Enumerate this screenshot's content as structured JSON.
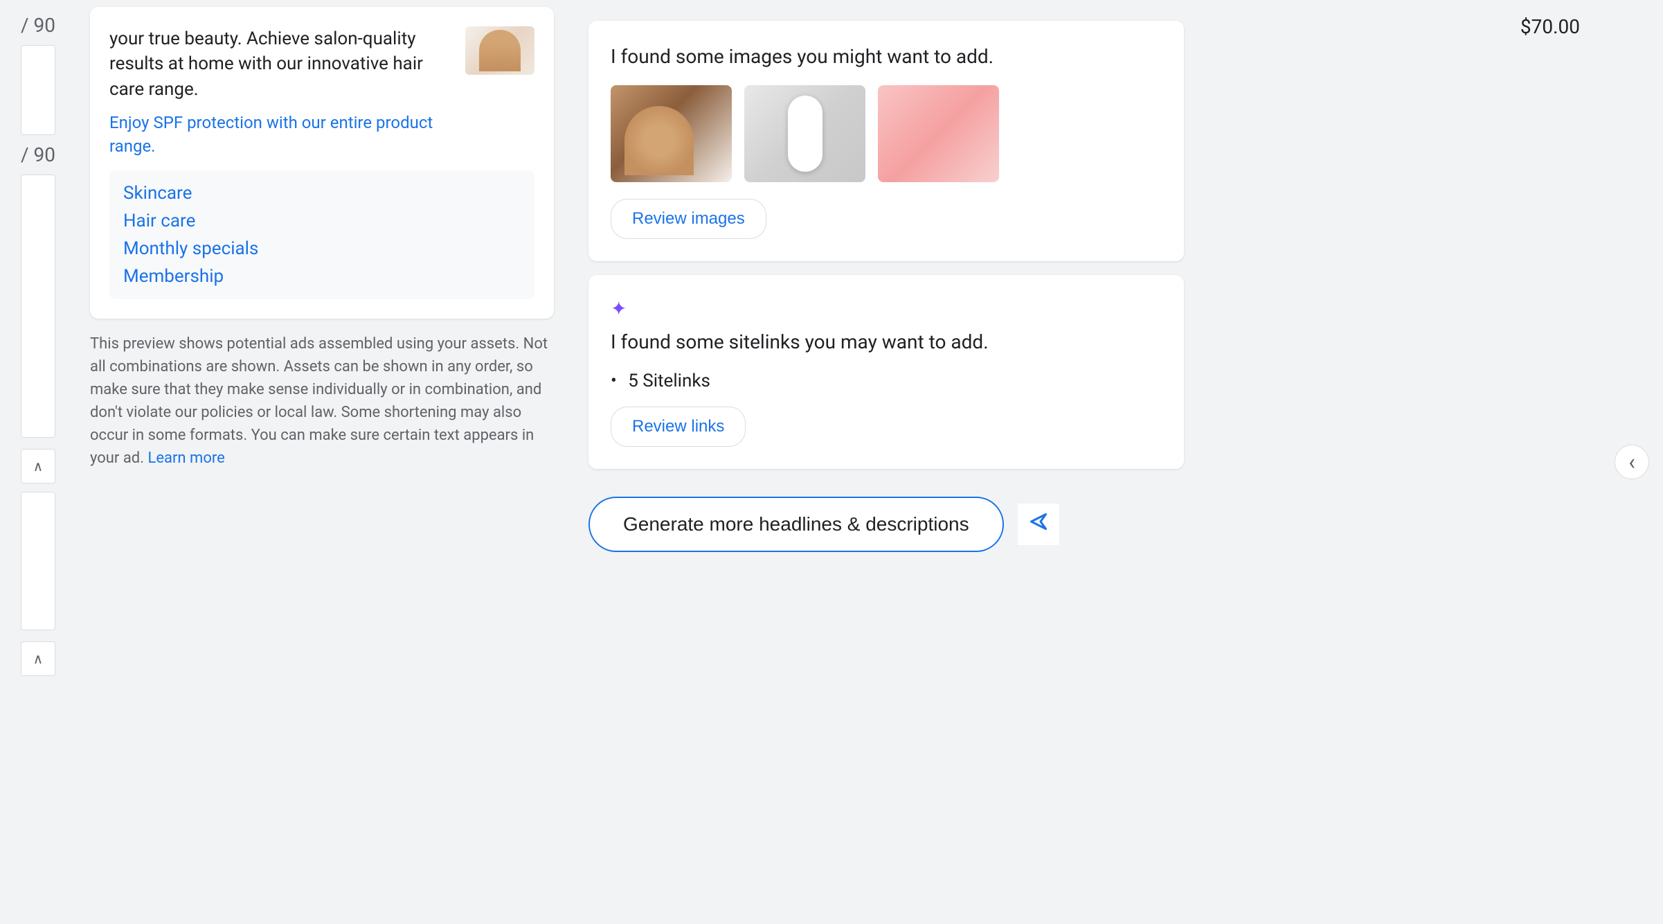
{
  "left": {
    "char_counter_1": "/ 90",
    "char_counter_2": "/ 90",
    "ad": {
      "description": "your true beauty. Achieve salon-quality results at home with our innovative hair care range.",
      "link_text": "Enjoy SPF protection with our entire product range.",
      "site_links": [
        "Skincare",
        "Hair care",
        "Monthly specials",
        "Membership"
      ]
    },
    "preview_notice": "This preview shows potential ads assembled using your assets. Not all combinations are shown. Assets can be shown in any order, so make sure that they make sense individually or in combination, and don't violate our policies or local law. Some shortening may also occur in some formats. You can make sure certain text appears in your ad.",
    "learn_more": "Learn more"
  },
  "right": {
    "price": "$70.00",
    "images_card": {
      "title": "I found some images you might want to add.",
      "review_btn": "Review images"
    },
    "sitelinks_card": {
      "sparkle": "✦",
      "title": "I found some sitelinks you may want to add.",
      "count_label": "5 Sitelinks",
      "review_btn": "Review links"
    },
    "generate_btn": "Generate more headlines & descriptions",
    "collapse_icon": "‹"
  }
}
